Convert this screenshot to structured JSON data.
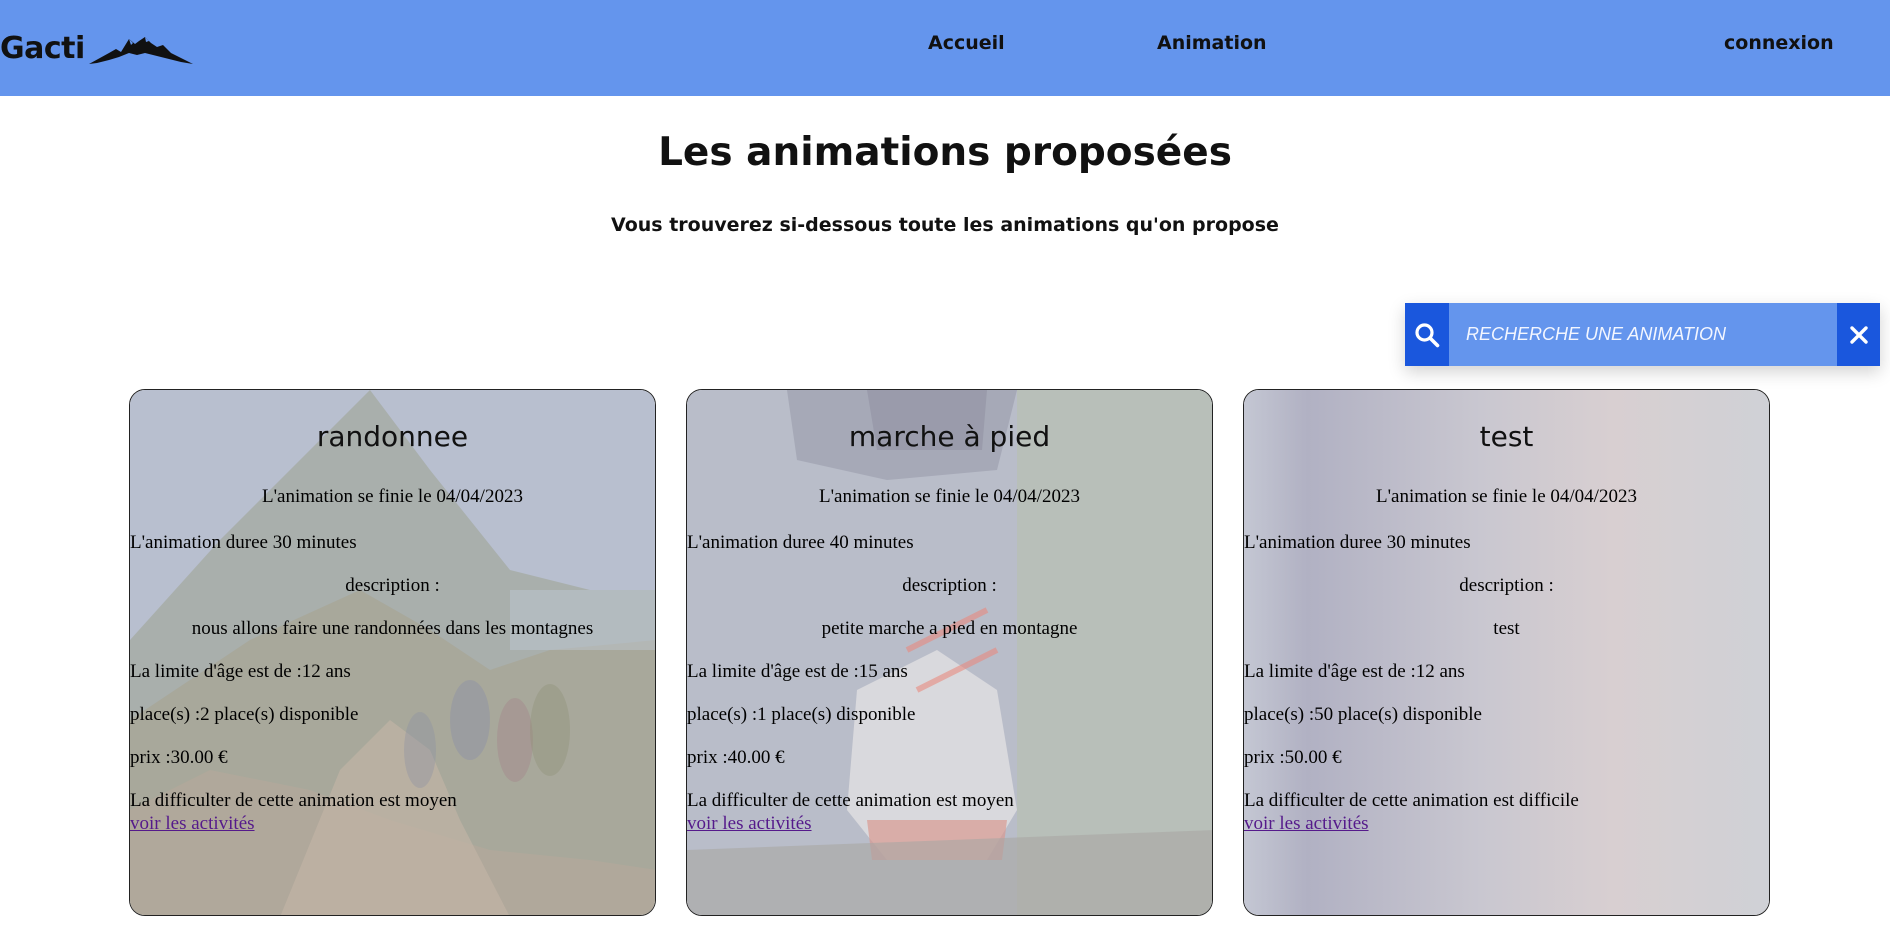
{
  "nav": {
    "brand": "Gacti",
    "logo_icon": "mountain-icon",
    "links": {
      "accueil": "Accueil",
      "animation": "Animation",
      "connexion": "connexion"
    },
    "bg_color": "#6495ed"
  },
  "header": {
    "title": "Les animations proposées",
    "subtitle": "Vous trouverez si-dessous toute les animations qu'on propose"
  },
  "search": {
    "placeholder": "RECHERCHE UNE ANIMATION",
    "value": "",
    "search_icon": "search-icon",
    "clear_icon": "close-icon",
    "button_color": "#1a57dd"
  },
  "cards": [
    {
      "title": "randonnee",
      "end_date": "L'animation se finie le 04/04/2023",
      "duration": "L'animation duree 30 minutes",
      "description_label": "description :",
      "description": "nous allons faire une randonnées dans les montagnes",
      "age_limit": "La limite d'âge est de :12 ans",
      "places": "place(s) :2 place(s) disponible",
      "price": "prix :30.00 €",
      "difficulty": "La difficulter de cette animation est moyen",
      "link": "voir les activités"
    },
    {
      "title": "marche à pied",
      "end_date": "L'animation se finie le 04/04/2023",
      "duration": "L'animation duree 40 minutes",
      "description_label": "description :",
      "description": "petite marche a pied en montagne",
      "age_limit": "La limite d'âge est de :15 ans",
      "places": "place(s) :1 place(s) disponible",
      "price": "prix :40.00 €",
      "difficulty": "La difficulter de cette animation est moyen",
      "link": "voir les activités"
    },
    {
      "title": "test",
      "end_date": "L'animation se finie le 04/04/2023",
      "duration": "L'animation duree 30 minutes",
      "description_label": "description :",
      "description": "test",
      "age_limit": "La limite d'âge est de :12 ans",
      "places": "place(s) :50 place(s) disponible",
      "price": "prix :50.00 €",
      "difficulty": "La difficulter de cette animation est difficile",
      "link": "voir les activités"
    }
  ]
}
